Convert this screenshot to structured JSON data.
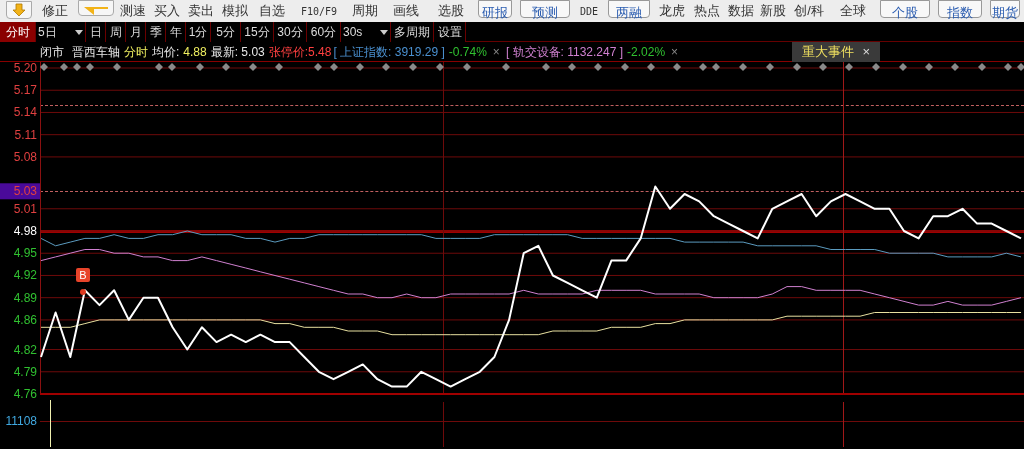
{
  "toolbar": {
    "items": [
      {
        "kind": "arrowdown"
      },
      {
        "kind": "text",
        "label": "修正"
      },
      {
        "kind": "arrowleft"
      },
      {
        "kind": "text",
        "label": "测速"
      },
      {
        "kind": "text",
        "label": "买入"
      },
      {
        "kind": "text",
        "label": "卖出"
      },
      {
        "kind": "text",
        "label": "模拟"
      },
      {
        "kind": "text",
        "label": "自选"
      },
      {
        "kind": "mono",
        "label": "F10/F9"
      },
      {
        "kind": "text",
        "label": "周期"
      },
      {
        "kind": "text",
        "label": "画线"
      },
      {
        "kind": "text",
        "label": "选股"
      },
      {
        "kind": "button",
        "label": "研报"
      },
      {
        "kind": "button",
        "label": "预测"
      },
      {
        "kind": "mono",
        "label": "DDE"
      },
      {
        "kind": "button",
        "label": "两融"
      },
      {
        "kind": "text",
        "label": "龙虎"
      },
      {
        "kind": "text",
        "label": "热点"
      },
      {
        "kind": "text",
        "label": "数据"
      },
      {
        "kind": "text",
        "label": "新股"
      },
      {
        "kind": "text",
        "label": "创/科"
      },
      {
        "kind": "text",
        "label": "全球"
      },
      {
        "kind": "button",
        "label": "个股"
      },
      {
        "kind": "button",
        "label": "指数"
      },
      {
        "kind": "button",
        "label": "期货"
      }
    ]
  },
  "period_tabs": [
    {
      "label": "分时",
      "selected": true,
      "dropdown": false
    },
    {
      "label": "5日",
      "selected": false,
      "dropdown": true
    },
    {
      "label": "日",
      "selected": false,
      "dropdown": false
    },
    {
      "label": "周",
      "selected": false,
      "dropdown": false
    },
    {
      "label": "月",
      "selected": false,
      "dropdown": false
    },
    {
      "label": "季",
      "selected": false,
      "dropdown": false
    },
    {
      "label": "年",
      "selected": false,
      "dropdown": false
    },
    {
      "label": "1分",
      "selected": false,
      "dropdown": false
    },
    {
      "label": "5分",
      "selected": false,
      "dropdown": false
    },
    {
      "label": "15分",
      "selected": false,
      "dropdown": false
    },
    {
      "label": "30分",
      "selected": false,
      "dropdown": false
    },
    {
      "label": "60分",
      "selected": false,
      "dropdown": false
    },
    {
      "label": "30s",
      "selected": false,
      "dropdown": true
    },
    {
      "label": "多周期",
      "selected": false,
      "dropdown": false
    },
    {
      "label": "设置",
      "selected": false,
      "dropdown": false
    }
  ],
  "info_bar": {
    "segments": [
      {
        "kind": "plain",
        "text": "闭市"
      },
      {
        "kind": "plain",
        "text": "晋西车轴"
      },
      {
        "kind": "highlight",
        "text": "分时"
      },
      {
        "kind": "plain",
        "text": "均价:"
      },
      {
        "kind": "highlight",
        "text": "4.88"
      },
      {
        "kind": "plain",
        "text": "最新: 5.03"
      },
      {
        "kind": "limit",
        "text": "张停价:5.48"
      },
      {
        "kind": "index",
        "text": "[ 上证指数: 3919.29 ]"
      },
      {
        "kind": "down",
        "text": "-0.74%"
      },
      {
        "kind": "close",
        "text": "×"
      },
      {
        "kind": "sector",
        "text": "[ 轨交设备: 1132.247 ]"
      },
      {
        "kind": "down",
        "text": "-2.02%"
      },
      {
        "kind": "close",
        "text": "×"
      }
    ],
    "event_tab": {
      "label": "重大事件",
      "close": "×"
    }
  },
  "price_marker": "5.03",
  "volume_axis_label": "11108",
  "chart_data": {
    "type": "line",
    "grid": true,
    "ylim": [
      4.76,
      5.2
    ],
    "yticks": [
      {
        "value": 5.2,
        "label": "5.20"
      },
      {
        "value": 5.17,
        "label": "5.17"
      },
      {
        "value": 5.14,
        "label": "5.14"
      },
      {
        "value": 5.11,
        "label": "5.11"
      },
      {
        "value": 5.08,
        "label": "5.08"
      },
      {
        "value": 5.01,
        "label": "5.01"
      },
      {
        "value": 4.98,
        "label": "4.98"
      },
      {
        "value": 4.95,
        "label": "4.95"
      },
      {
        "value": 4.92,
        "label": "4.92"
      },
      {
        "value": 4.89,
        "label": "4.89"
      },
      {
        "value": 4.86,
        "label": "4.86"
      },
      {
        "value": 4.82,
        "label": "4.82"
      },
      {
        "value": 4.79,
        "label": "4.79"
      },
      {
        "value": 4.76,
        "label": "4.76"
      }
    ],
    "categories": [
      null,
      null,
      null,
      null,
      null,
      null,
      null,
      null,
      null,
      null,
      null,
      null,
      null,
      null,
      null,
      null,
      null,
      null,
      null,
      null,
      null,
      null,
      null,
      null,
      null,
      null,
      null,
      null,
      null,
      null,
      null,
      null,
      null,
      null,
      null,
      null,
      null,
      null,
      null,
      null,
      null,
      null,
      null,
      null,
      null,
      null,
      null,
      null,
      null,
      null,
      null,
      null,
      null,
      null,
      null,
      null,
      null,
      null,
      null,
      null,
      null,
      null,
      null,
      null,
      null,
      null,
      null,
      null
    ],
    "series": [
      {
        "color": "#5b9bbf",
        "values": [
          4.97,
          4.96,
          4.965,
          4.97,
          4.97,
          4.975,
          4.97,
          4.97,
          4.975,
          4.975,
          4.98,
          4.975,
          4.975,
          4.975,
          4.97,
          4.97,
          4.965,
          4.97,
          4.97,
          4.975,
          4.975,
          4.975,
          4.975,
          4.975,
          4.975,
          4.975,
          4.975,
          4.97,
          4.97,
          4.97,
          4.97,
          4.975,
          4.975,
          4.975,
          4.975,
          4.975,
          4.975,
          4.97,
          4.97,
          4.97,
          4.97,
          4.97,
          4.97,
          4.97,
          4.965,
          4.965,
          4.965,
          4.965,
          4.965,
          4.96,
          4.96,
          4.96,
          4.96,
          4.96,
          4.955,
          4.955,
          4.955,
          4.955,
          4.95,
          4.95,
          4.95,
          4.95,
          4.945,
          4.945,
          4.945,
          4.945,
          4.95,
          4.945
        ]
      },
      {
        "color": "#d080d0",
        "values": [
          4.94,
          4.945,
          4.95,
          4.955,
          4.955,
          4.95,
          4.95,
          4.945,
          4.945,
          4.94,
          4.94,
          4.945,
          4.94,
          4.935,
          4.93,
          4.925,
          4.92,
          4.915,
          4.91,
          4.905,
          4.9,
          4.895,
          4.895,
          4.89,
          4.89,
          4.895,
          4.89,
          4.89,
          4.895,
          4.895,
          4.895,
          4.895,
          4.895,
          4.9,
          4.895,
          4.895,
          4.895,
          4.895,
          4.9,
          4.9,
          4.9,
          4.9,
          4.895,
          4.895,
          4.895,
          4.895,
          4.89,
          4.89,
          4.89,
          4.89,
          4.895,
          4.905,
          4.905,
          4.9,
          4.9,
          4.9,
          4.9,
          4.895,
          4.89,
          4.885,
          4.88,
          4.88,
          4.885,
          4.88,
          4.88,
          4.88,
          4.885,
          4.89
        ]
      },
      {
        "color": "#e8e0a0",
        "values": [
          4.85,
          4.85,
          4.85,
          4.855,
          4.86,
          4.86,
          4.86,
          4.86,
          4.86,
          4.86,
          4.86,
          4.86,
          4.86,
          4.86,
          4.86,
          4.86,
          4.855,
          4.855,
          4.85,
          4.85,
          4.85,
          4.845,
          4.845,
          4.845,
          4.84,
          4.84,
          4.84,
          4.84,
          4.84,
          4.84,
          4.84,
          4.84,
          4.84,
          4.84,
          4.84,
          4.845,
          4.845,
          4.845,
          4.845,
          4.85,
          4.85,
          4.85,
          4.855,
          4.855,
          4.86,
          4.86,
          4.86,
          4.86,
          4.86,
          4.86,
          4.86,
          4.865,
          4.865,
          4.865,
          4.865,
          4.865,
          4.865,
          4.87,
          4.87,
          4.87,
          4.87,
          4.87,
          4.87,
          4.87,
          4.87,
          4.87,
          4.87,
          4.87
        ]
      },
      {
        "color": "#ffffff",
        "values": [
          4.81,
          4.87,
          4.81,
          4.9,
          4.88,
          4.9,
          4.86,
          4.89,
          4.89,
          4.85,
          4.82,
          4.85,
          4.83,
          4.84,
          4.83,
          4.84,
          4.83,
          4.83,
          4.81,
          4.79,
          4.78,
          4.79,
          4.8,
          4.78,
          4.77,
          4.77,
          4.79,
          4.78,
          4.77,
          4.78,
          4.79,
          4.81,
          4.86,
          4.95,
          4.96,
          4.92,
          4.91,
          4.9,
          4.89,
          4.94,
          4.94,
          4.97,
          5.04,
          5.01,
          5.03,
          5.02,
          5.0,
          4.99,
          4.98,
          4.97,
          5.01,
          5.02,
          5.03,
          5.0,
          5.02,
          5.03,
          5.02,
          5.01,
          5.01,
          4.98,
          4.97,
          5.0,
          5.0,
          5.01,
          4.99,
          4.99,
          4.98,
          4.97
        ]
      }
    ]
  },
  "buy_marker": {
    "label": "B"
  }
}
